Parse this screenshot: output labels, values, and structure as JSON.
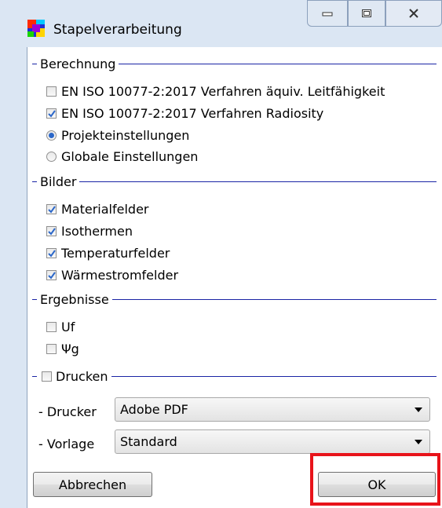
{
  "window": {
    "title": "Stapelverarbeitung",
    "controls": {
      "minimize": "minimize",
      "maximize": "maximize",
      "close": "close"
    }
  },
  "berechnung": {
    "legend": "Berechnung",
    "options": [
      {
        "label": "EN ISO 10077-2:2017 Verfahren äquiv. Leitfähigkeit",
        "checked": false
      },
      {
        "label": "EN ISO 10077-2:2017 Verfahren Radiosity",
        "checked": true
      }
    ],
    "radios": [
      {
        "label": "Projekteinstellungen",
        "selected": true
      },
      {
        "label": "Globale Einstellungen",
        "selected": false
      }
    ]
  },
  "bilder": {
    "legend": "Bilder",
    "options": [
      {
        "label": "Materialfelder",
        "checked": true
      },
      {
        "label": "Isothermen",
        "checked": true
      },
      {
        "label": "Temperaturfelder",
        "checked": true
      },
      {
        "label": "Wärmestromfelder",
        "checked": true
      }
    ]
  },
  "ergebnisse": {
    "legend": "Ergebnisse",
    "options": [
      {
        "label": "Uf",
        "checked": false
      },
      {
        "label": "Ψg",
        "checked": false
      }
    ]
  },
  "drucken": {
    "legend": "Drucken",
    "checked": false,
    "drucker_label": "- Drucker",
    "drucker_value": "Adobe PDF",
    "vorlage_label": "- Vorlage",
    "vorlage_value": "Standard"
  },
  "buttons": {
    "cancel": "Abbrechen",
    "ok": "OK"
  },
  "colors": {
    "legend_rule": "#1a24a5",
    "highlight": "#e8131a",
    "check": "#2b67c9"
  }
}
